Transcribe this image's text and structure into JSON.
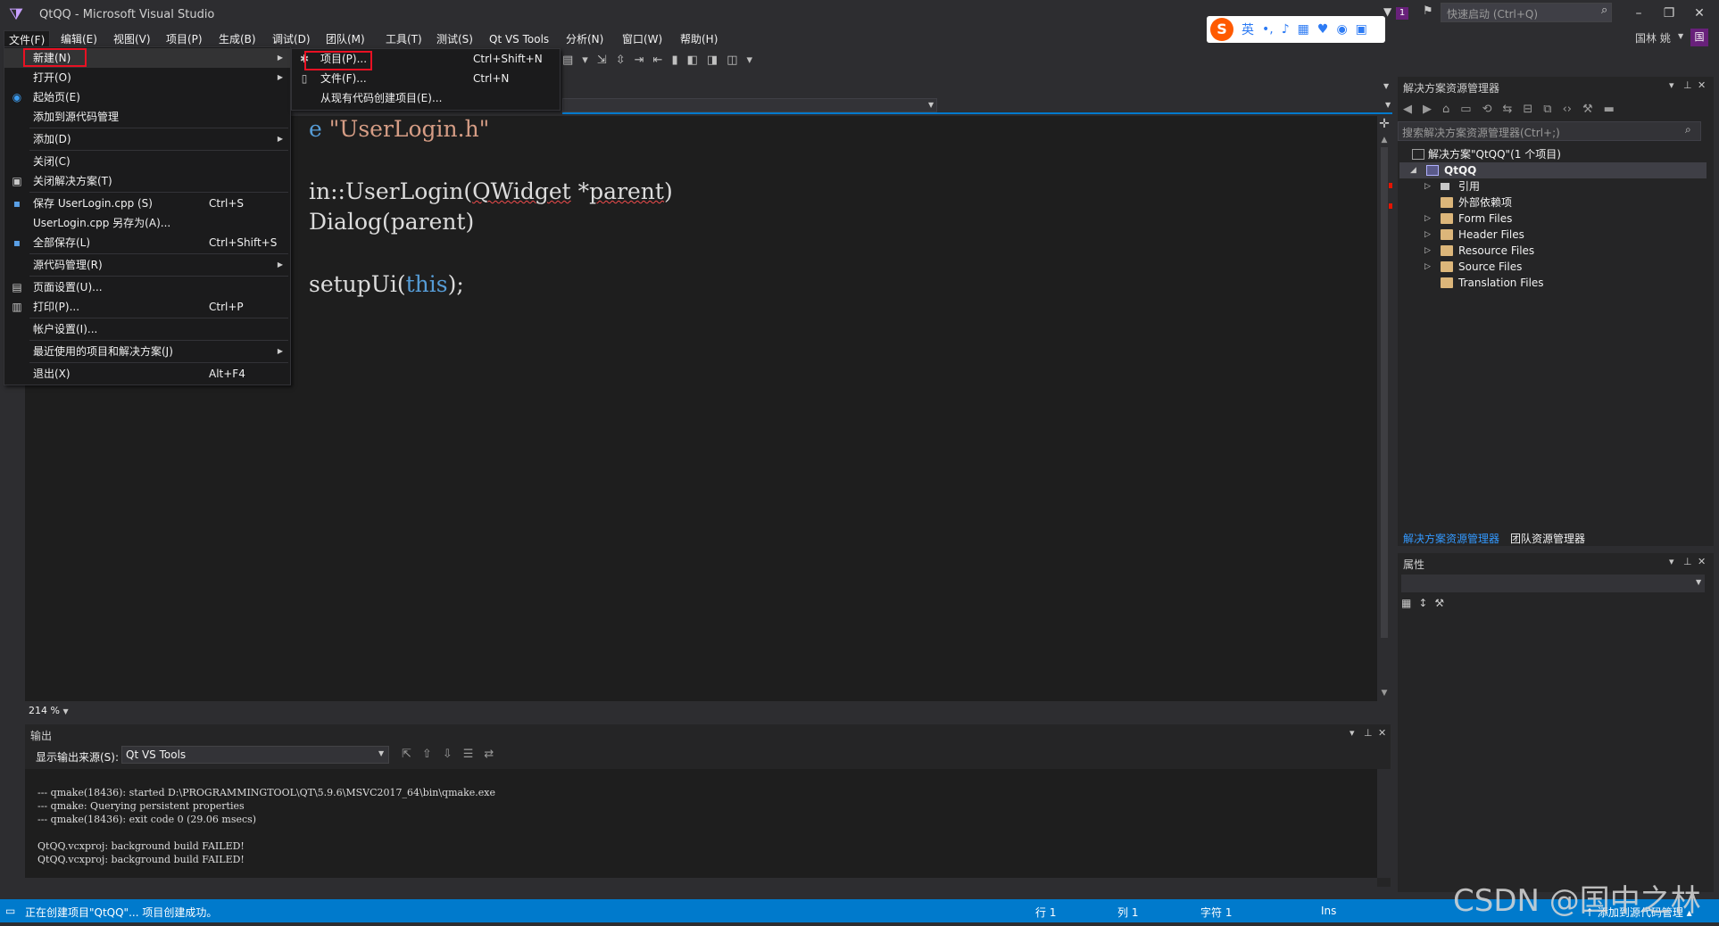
{
  "window": {
    "title": "QtQQ - Microsoft Visual Studio",
    "quick_launch_placeholder": "快速启动 (Ctrl+Q)",
    "notification_count": "1",
    "user_name": "国林 姚",
    "user_initial": "国",
    "ime_label": "英"
  },
  "menubar": [
    {
      "label": "文件(F)"
    },
    {
      "label": "编辑(E)"
    },
    {
      "label": "视图(V)"
    },
    {
      "label": "项目(P)"
    },
    {
      "label": "生成(B)"
    },
    {
      "label": "调试(D)"
    },
    {
      "label": "团队(M)"
    },
    {
      "label": "工具(T)"
    },
    {
      "label": "测试(S)"
    },
    {
      "label": "Qt VS Tools"
    },
    {
      "label": "分析(N)"
    },
    {
      "label": "窗口(W)"
    },
    {
      "label": "帮助(H)"
    }
  ],
  "file_menu": {
    "items": [
      {
        "label": "新建(N)",
        "shortcut": ""
      },
      {
        "label": "打开(O)",
        "shortcut": ""
      },
      {
        "label": "起始页(E)",
        "shortcut": ""
      },
      {
        "label": "添加到源代码管理",
        "shortcut": ""
      },
      {
        "label": "添加(D)",
        "shortcut": ""
      },
      {
        "label": "关闭(C)",
        "shortcut": ""
      },
      {
        "label": "关闭解决方案(T)",
        "shortcut": ""
      },
      {
        "label": "保存 UserLogin.cpp (S)",
        "shortcut": "Ctrl+S"
      },
      {
        "label": "UserLogin.cpp 另存为(A)...",
        "shortcut": ""
      },
      {
        "label": "全部保存(L)",
        "shortcut": "Ctrl+Shift+S"
      },
      {
        "label": "源代码管理(R)",
        "shortcut": ""
      },
      {
        "label": "页面设置(U)...",
        "shortcut": ""
      },
      {
        "label": "打印(P)...",
        "shortcut": "Ctrl+P"
      },
      {
        "label": "帐户设置(I)...",
        "shortcut": ""
      },
      {
        "label": "最近使用的项目和解决方案(J)",
        "shortcut": ""
      },
      {
        "label": "退出(X)",
        "shortcut": "Alt+F4"
      }
    ]
  },
  "new_submenu": {
    "items": [
      {
        "label": "项目(P)...",
        "shortcut": "Ctrl+Shift+N"
      },
      {
        "label": "文件(F)...",
        "shortcut": "Ctrl+N"
      },
      {
        "label": "从现有代码创建项目(E)...",
        "shortcut": ""
      }
    ]
  },
  "editor": {
    "line1_kw": "e",
    "line1_str": "\"UserLogin.h\"",
    "line2_a": "in::UserLogin(",
    "line2_b": "QWidget",
    "line2_c": " *",
    "line2_d": "parent",
    "line2_e": ")",
    "line3": "Dialog(parent)",
    "line4_a": "setupUi(",
    "line4_b": "this",
    "line4_c": ");",
    "zoom": "214 %"
  },
  "solution_explorer": {
    "title": "解决方案资源管理器",
    "search_placeholder": "搜索解决方案资源管理器(Ctrl+;)",
    "solution_label": "解决方案\"QtQQ\"(1 个项目)",
    "project_label": "QtQQ",
    "nodes": [
      {
        "label": "引用"
      },
      {
        "label": "外部依赖项"
      },
      {
        "label": "Form Files"
      },
      {
        "label": "Header Files"
      },
      {
        "label": "Resource Files"
      },
      {
        "label": "Source Files"
      },
      {
        "label": "Translation Files"
      }
    ],
    "tab_solution": "解决方案资源管理器",
    "tab_team": "团队资源管理器"
  },
  "properties": {
    "title": "属性"
  },
  "output": {
    "title": "输出",
    "source_label": "显示输出来源(S):",
    "source_value": "Qt VS Tools",
    "lines": [
      "--- qmake(18436): started D:\\PROGRAMMINGTOOL\\QT\\5.9.6\\MSVC2017_64\\bin\\qmake.exe",
      "--- qmake: Querying persistent properties",
      "--- qmake(18436): exit code 0 (29.06 msecs)",
      "",
      "QtQQ.vcxproj: background build FAILED!",
      "QtQQ.vcxproj: background build FAILED!"
    ]
  },
  "statusbar": {
    "message": "正在创建项目\"QtQQ\"... 项目创建成功。",
    "line": "行 1",
    "col": "列 1",
    "char": "字符 1",
    "mode": "Ins",
    "source_control": "↑ 添加到源代码管理 ▴"
  },
  "watermark": "CSDN @国中之林",
  "colors": {
    "accent": "#007acc",
    "highlight_box": "#e81123",
    "background": "#2d2d30",
    "editor_bg": "#1e1e1e"
  }
}
